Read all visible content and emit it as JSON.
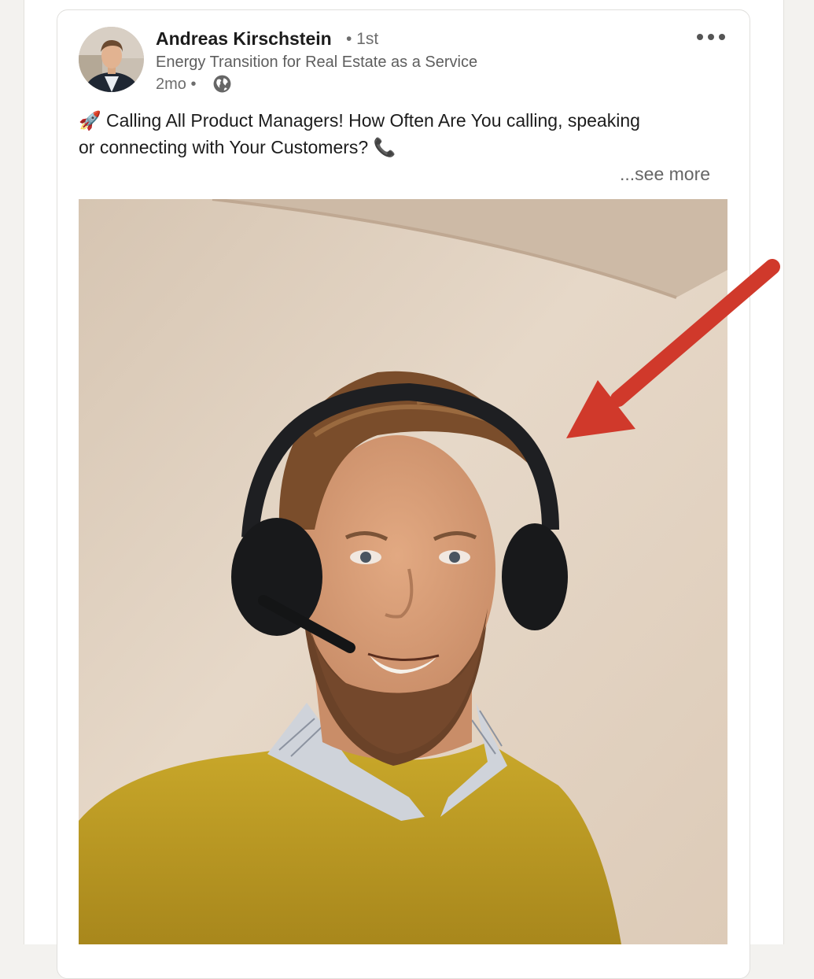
{
  "post": {
    "author": {
      "name": "Andreas Kirschstein",
      "connection": "• 1st",
      "headline": "Energy Transition for Real Estate as a Service",
      "time": "2mo •",
      "visibility_icon": "globe-icon",
      "avatar_icon": "profile-photo"
    },
    "menu_icon": "ellipsis-icon",
    "text_line1": "🚀 Calling All Product Managers! How Often Are You calling, speaking",
    "text_line2": "or connecting with Your Customers? 📞",
    "see_more": "...see more",
    "image": {
      "description_icon": "photo-person-headset",
      "annotation_icon": "red-arrow-icon",
      "annotation_color": "#d0392b"
    }
  },
  "colors": {
    "page_background": "#f3f2ef",
    "card_background": "#ffffff",
    "text_primary": "#1c1c1c",
    "text_secondary": "#666666"
  }
}
